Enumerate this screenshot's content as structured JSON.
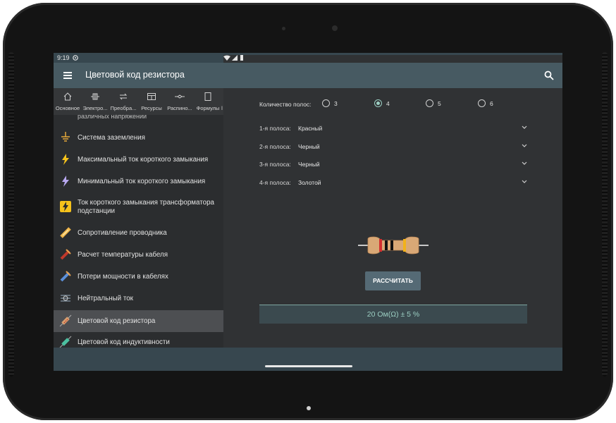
{
  "status": {
    "time": "9:19"
  },
  "toolbar": {
    "title": "Цветовой код резистора"
  },
  "tabs": [
    {
      "label": "Основное",
      "icon": "home-icon"
    },
    {
      "label": "Электро...",
      "icon": "electric-icon"
    },
    {
      "label": "Преобра...",
      "icon": "convert-icon"
    },
    {
      "label": "Ресурсы",
      "icon": "resources-icon"
    },
    {
      "label": "Распино...",
      "icon": "pinout-icon"
    },
    {
      "label": "Формулы",
      "icon": "formulas-icon"
    },
    {
      "label": "l",
      "icon": "more-icon"
    }
  ],
  "sidebar": {
    "partial_item": "различных напряжений",
    "items": [
      {
        "label": "Система заземления",
        "icon": "grounding-icon"
      },
      {
        "label": "Максимальный ток короткого замыкания",
        "icon": "lightning-icon"
      },
      {
        "label": "Минимальный ток короткого замыкания",
        "icon": "lightning-icon"
      },
      {
        "label": "Ток короткого замыкания трансформатора подстанции",
        "icon": "lightning-icon"
      },
      {
        "label": "Сопротивление проводника",
        "icon": "conductor-icon"
      },
      {
        "label": "Расчет температуры кабеля",
        "icon": "cable-temperature-icon"
      },
      {
        "label": "Потери мощности в кабелях",
        "icon": "cable-loss-icon"
      },
      {
        "label": "Нейтральный ток",
        "icon": "neutral-current-icon"
      },
      {
        "label": "Цветовой код резистора",
        "icon": "resistor-icon"
      },
      {
        "label": "Цветовой код индуктивности",
        "icon": "inductor-icon"
      }
    ]
  },
  "calc": {
    "count_label": "Количество полос:",
    "options": [
      "3",
      "4",
      "5",
      "6"
    ],
    "selected": "4",
    "bands": [
      {
        "label": "1-я полоса:",
        "value": "Красный",
        "color": "#d32f2f"
      },
      {
        "label": "2-я полоса:",
        "value": "Черный",
        "color": "#111111"
      },
      {
        "label": "3-я полоса:",
        "value": "Черный",
        "color": "#111111"
      },
      {
        "label": "4-я полоса:",
        "value": "Золотой",
        "color": "#f2b21a"
      }
    ],
    "button": "РАССЧИТАТЬ",
    "result": "20 Ом(Ω) ± 5 %"
  },
  "colors": {
    "toolbar": "#475a62",
    "accent": "#9ccfc3",
    "button": "#556a75"
  }
}
